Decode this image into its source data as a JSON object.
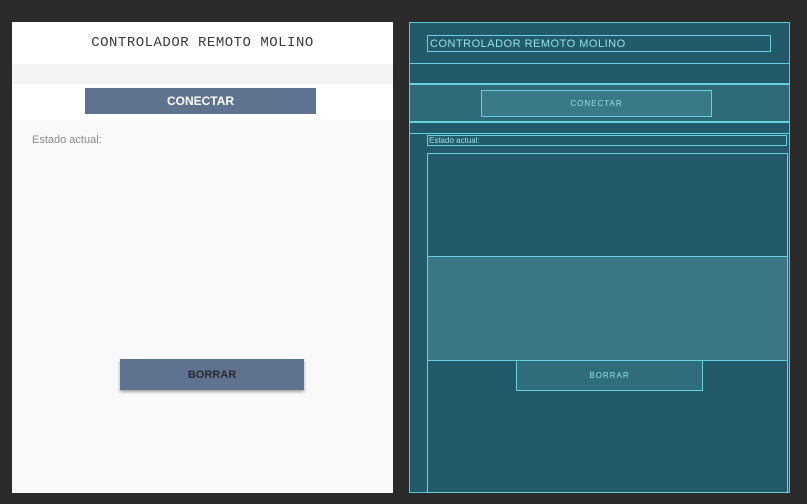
{
  "app": {
    "title": "CONTROLADOR REMOTO MOLINO",
    "connect_label": "CONECTAR",
    "status_label": "Estado actual:",
    "clear_label": "BORRAR"
  },
  "blueprint": {
    "title": "CONTROLADOR REMOTO MOLINO",
    "connect_label": "CONECTAR",
    "status_label": "Estado actual:",
    "clear_label": "BORRAR"
  },
  "colors": {
    "button": "#5f7391",
    "canvas_bg": "#2b2b2b",
    "blueprint_bg": "#235a69",
    "blueprint_line": "#65d2de"
  }
}
